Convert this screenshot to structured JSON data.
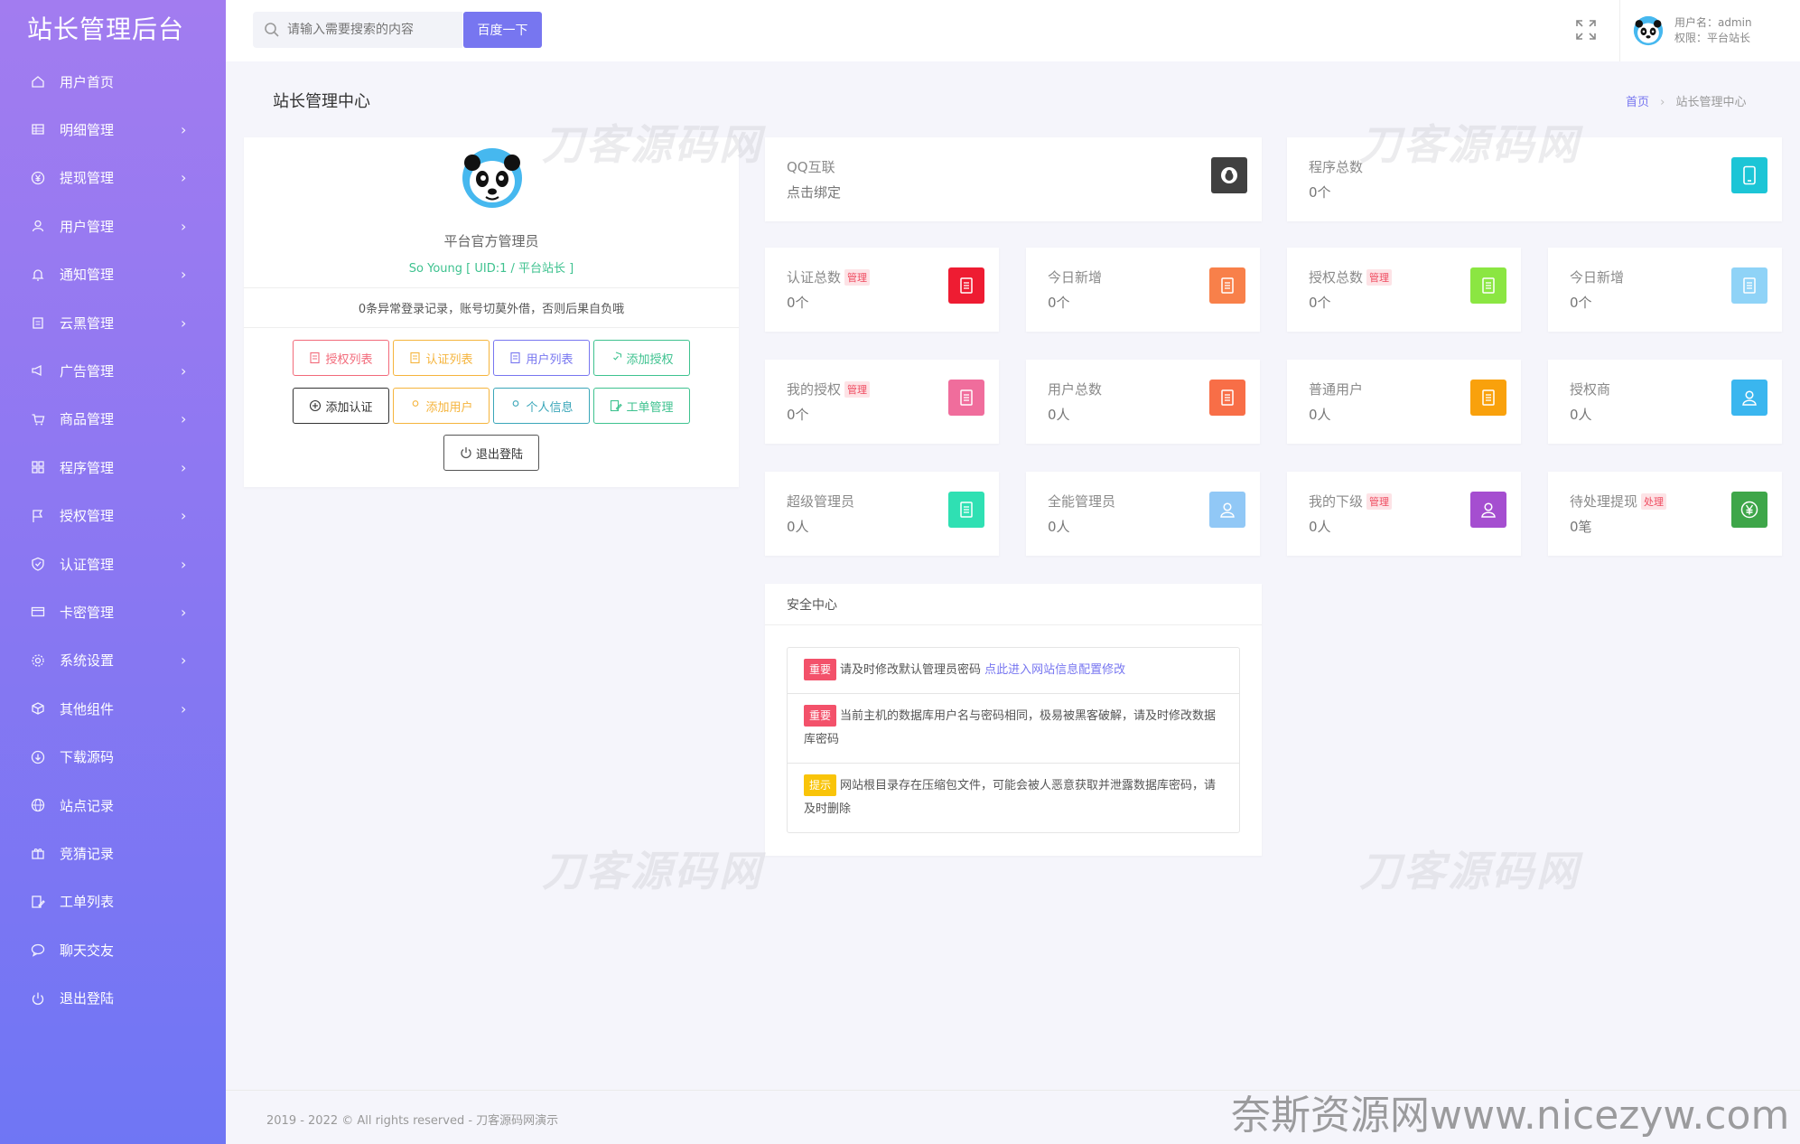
{
  "brand": "站长管理后台",
  "sidebar": {
    "items": [
      {
        "label": "用户首页",
        "icon": "home-icon",
        "chevron": false
      },
      {
        "label": "明细管理",
        "icon": "list-icon",
        "chevron": true
      },
      {
        "label": "提现管理",
        "icon": "yen-icon",
        "chevron": true
      },
      {
        "label": "用户管理",
        "icon": "user-icon",
        "chevron": true
      },
      {
        "label": "通知管理",
        "icon": "bell-icon",
        "chevron": true
      },
      {
        "label": "云黑管理",
        "icon": "clipboard-icon",
        "chevron": true
      },
      {
        "label": "广告管理",
        "icon": "megaphone-icon",
        "chevron": true
      },
      {
        "label": "商品管理",
        "icon": "cart-icon",
        "chevron": true
      },
      {
        "label": "程序管理",
        "icon": "grid-icon",
        "chevron": true
      },
      {
        "label": "授权管理",
        "icon": "flag-icon",
        "chevron": true
      },
      {
        "label": "认证管理",
        "icon": "shield-icon",
        "chevron": true
      },
      {
        "label": "卡密管理",
        "icon": "card-icon",
        "chevron": true
      },
      {
        "label": "系统设置",
        "icon": "gear-icon",
        "chevron": true
      },
      {
        "label": "其他组件",
        "icon": "box-icon",
        "chevron": true
      },
      {
        "label": "下载源码",
        "icon": "download-icon",
        "chevron": false
      },
      {
        "label": "站点记录",
        "icon": "globe-icon",
        "chevron": false
      },
      {
        "label": "竞猜记录",
        "icon": "gift-icon",
        "chevron": false
      },
      {
        "label": "工单列表",
        "icon": "edit-icon",
        "chevron": false
      },
      {
        "label": "聊天交友",
        "icon": "chat-icon",
        "chevron": false
      },
      {
        "label": "退出登陆",
        "icon": "power-icon",
        "chevron": false
      }
    ],
    "chevron_symbol": "›"
  },
  "header": {
    "search_placeholder": "请输入需要搜索的内容",
    "search_button": "百度一下",
    "username_label": "用户名：admin",
    "role_label": "权限：平台站长"
  },
  "page": {
    "title": "站长管理中心",
    "breadcrumb_home": "首页",
    "breadcrumb_sep": "›",
    "breadcrumb_current": "站长管理中心"
  },
  "profile": {
    "name": "平台官方管理员",
    "uid_line": "So Young [ UID:1 / 平台站长 ]",
    "notice": "0条异常登录记录，账号切莫外借，否则后果自负哦",
    "buttons": [
      {
        "label": "授权列表",
        "color": "#f26a7a"
      },
      {
        "label": "认证列表",
        "color": "#f5b43c"
      },
      {
        "label": "用户列表",
        "color": "#7776f0"
      },
      {
        "label": "添加授权",
        "color": "#3ec28f"
      },
      {
        "label": "添加认证",
        "color": "#333333"
      },
      {
        "label": "添加用户",
        "color": "#f5b43c"
      },
      {
        "label": "个人信息",
        "color": "#3aa6b9"
      },
      {
        "label": "工单管理",
        "color": "#3ec28f"
      }
    ],
    "logout_button": "退出登陆"
  },
  "qq_card": {
    "title": "QQ互联",
    "value": "点击绑定",
    "icon_color": "#404040",
    "icon": "qq-icon"
  },
  "program_card": {
    "title": "程序总数",
    "value": "0个",
    "icon_color": "#1cc5d6",
    "icon": "tablet-icon"
  },
  "stats": [
    {
      "title": "认证总数",
      "badge": "管理",
      "value": "0个",
      "color": "#ee1c32",
      "icon": "file-icon"
    },
    {
      "title": "今日新增",
      "badge": "",
      "value": "0个",
      "color": "#f8804a",
      "icon": "file-icon"
    },
    {
      "title": "授权总数",
      "badge": "管理",
      "value": "0个",
      "color": "#8be642",
      "icon": "file-icon"
    },
    {
      "title": "今日新增",
      "badge": "",
      "value": "0个",
      "color": "#8fd3f7",
      "icon": "file-icon"
    },
    {
      "title": "我的授权",
      "badge": "管理",
      "value": "0个",
      "color": "#f06d9c",
      "icon": "file-icon"
    },
    {
      "title": "用户总数",
      "badge": "",
      "value": "0人",
      "color": "#f86e47",
      "icon": "file-icon"
    },
    {
      "title": "普通用户",
      "badge": "",
      "value": "0人",
      "color": "#f9a10c",
      "icon": "file-icon"
    },
    {
      "title": "授权商",
      "badge": "",
      "value": "0人",
      "color": "#3ab6ef",
      "icon": "user-icon"
    },
    {
      "title": "超级管理员",
      "badge": "",
      "value": "0人",
      "color": "#2fe0b3",
      "icon": "file-icon"
    },
    {
      "title": "全能管理员",
      "badge": "",
      "value": "0人",
      "color": "#91c8f6",
      "icon": "user-icon"
    },
    {
      "title": "我的下级",
      "badge": "管理",
      "value": "0人",
      "color": "#a54ed0",
      "icon": "user-icon"
    },
    {
      "title": "待处理提现",
      "badge": "处理",
      "value": "0笔",
      "color": "#3ea649",
      "icon": "yen-icon"
    }
  ],
  "security": {
    "title": "安全中心",
    "rows": [
      {
        "tag": "重要",
        "tag_color": "#f3516a",
        "text": "请及时修改默认管理员密码 ",
        "link": "点此进入网站信息配置修改"
      },
      {
        "tag": "重要",
        "tag_color": "#f3516a",
        "text": "当前主机的数据库用户名与密码相同，极易被黑客破解，请及时修改数据库密码",
        "link": ""
      },
      {
        "tag": "提示",
        "tag_color": "#f9c409",
        "text": "网站根目录存在压缩包文件，可能会被人恶意获取并泄露数据库密码，请及时删除",
        "link": ""
      }
    ]
  },
  "footer": {
    "copyright": "2019 - 2022 © All rights reserved - 刀客源码网演示"
  },
  "watermarks": {
    "text": "刀客源码网",
    "site": "奈斯资源网www.nicezyw.com"
  }
}
